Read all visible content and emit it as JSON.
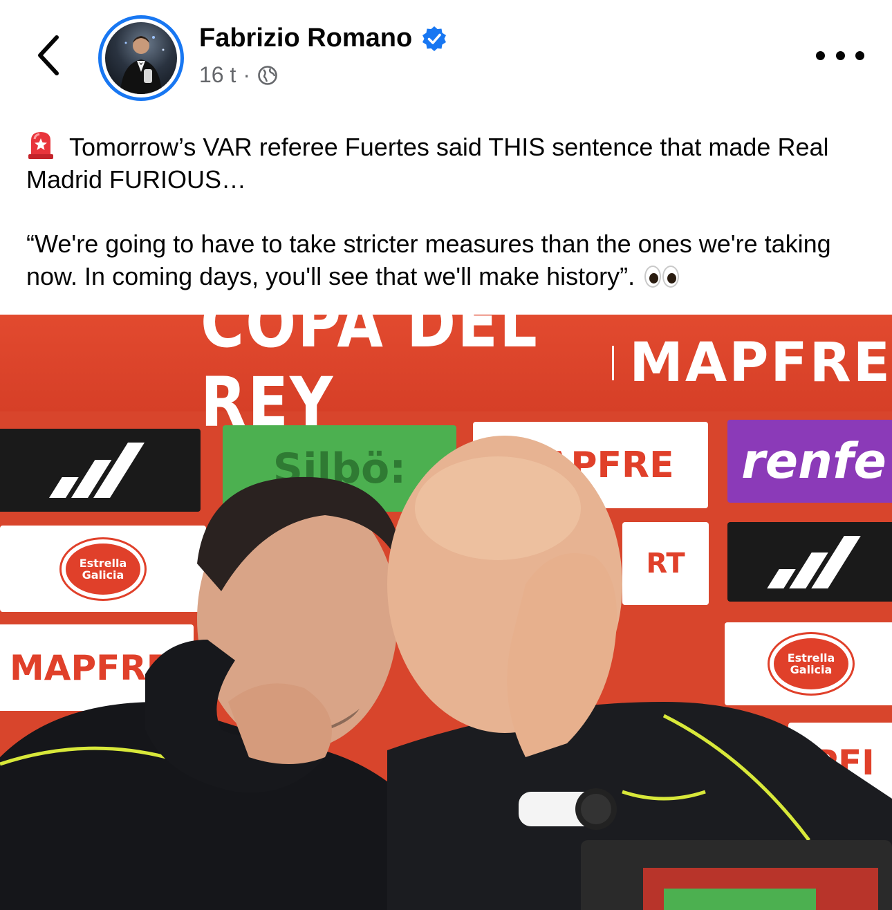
{
  "post": {
    "author": "Fabrizio Romano",
    "verified": true,
    "timestamp": "16 t",
    "separator": "·",
    "text_line1": "Tomorrow’s VAR referee Fuertes said THIS sentence that made Real Madrid FURIOUS…",
    "text_line2": "“We're going to have to take stricter measures than the ones we're taking now. In coming days, you'll see that we'll make history”."
  },
  "photo": {
    "banner_left": "COPA DEL REY",
    "banner_right": "MAPFRE",
    "board_silbo": "Silbö:",
    "board_mapfre": "MAPFRE",
    "board_renfe": "renfe",
    "board_estrella": "Estrella Galicia",
    "board_mapfre_left": "MAPFRE",
    "board_pf": "PFI",
    "board_rt": "RT"
  },
  "icons": {
    "back": "chevron-left-icon",
    "verified": "verified-badge-icon",
    "audience": "globe-icon",
    "more": "more-dots-icon",
    "siren": "rotating-light-emoji",
    "eyes": "eyes-emoji"
  },
  "colors": {
    "accent": "#1877f2",
    "text": "#050505",
    "muted": "#65676b"
  }
}
